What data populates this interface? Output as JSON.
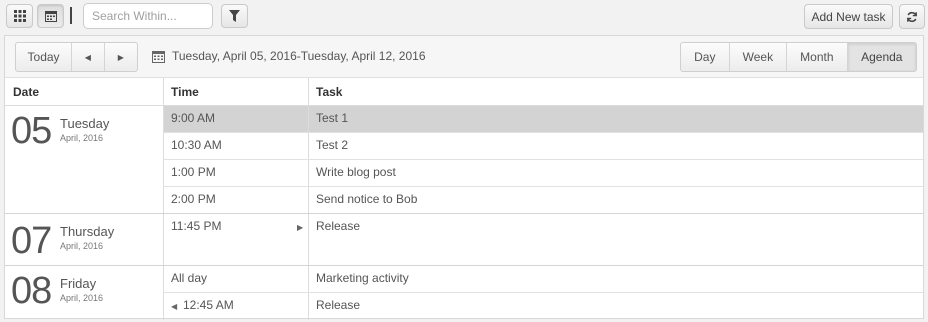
{
  "toolbar": {
    "search_placeholder": "Search Within...",
    "add_task_label": "Add New task"
  },
  "navbar": {
    "today_label": "Today",
    "date_range": "Tuesday, April 05, 2016-Tuesday, April 12, 2016",
    "views": [
      "Day",
      "Week",
      "Month",
      "Agenda"
    ],
    "active_view": "Agenda"
  },
  "columns": {
    "date": "Date",
    "time": "Time",
    "task": "Task"
  },
  "days": [
    {
      "day": "05",
      "weekday": "Tuesday",
      "month_year": "April, 2016",
      "events": [
        {
          "time": "9:00 AM",
          "task": "Test 1",
          "selected": true
        },
        {
          "time": "10:30 AM",
          "task": "Test 2"
        },
        {
          "time": "1:00 PM",
          "task": "Write blog post"
        },
        {
          "time": "2:00 PM",
          "task": "Send notice to Bob"
        }
      ]
    },
    {
      "day": "07",
      "weekday": "Thursday",
      "month_year": "April, 2016",
      "events": [
        {
          "time": "11:45 PM",
          "task": "Release",
          "continues_next": true
        }
      ]
    },
    {
      "day": "08",
      "weekday": "Friday",
      "month_year": "April, 2016",
      "events": [
        {
          "time": "All day",
          "task": "Marketing activity"
        },
        {
          "time": "12:45 AM",
          "task": "Release",
          "continued_from_prev": true
        }
      ]
    }
  ]
}
